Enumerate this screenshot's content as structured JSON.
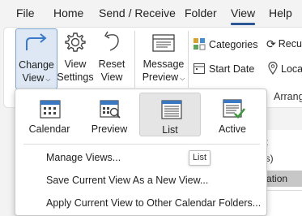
{
  "menubar": {
    "tabs": [
      {
        "label": "File"
      },
      {
        "label": "Home"
      },
      {
        "label": "Send / Receive"
      },
      {
        "label": "Folder"
      },
      {
        "label": "View"
      },
      {
        "label": "Help"
      }
    ],
    "active_tab": "View"
  },
  "ribbon": {
    "change_view": {
      "line1": "Change",
      "line2": "View"
    },
    "view_settings": {
      "line1": "View",
      "line2": "Settings"
    },
    "reset_view": {
      "line1": "Reset",
      "line2": "View"
    },
    "message_preview": {
      "line1": "Message",
      "line2": "Preview"
    },
    "categories": "Categories",
    "start_date": "Start Date",
    "recur": "Recur",
    "locat": "Locat",
    "arrang": "Arrang"
  },
  "dropdown": {
    "views": [
      {
        "label": "Calendar"
      },
      {
        "label": "Preview"
      },
      {
        "label": "List"
      },
      {
        "label": "Active"
      }
    ],
    "selected_view": "List",
    "items": [
      {
        "label": "Manage Views..."
      },
      {
        "label": "Save Current View As a New View..."
      },
      {
        "label": "Apply Current View to Other Calendar Folders..."
      }
    ]
  },
  "tooltip": {
    "text": "List"
  },
  "background_pane": {
    "col_header": "ict",
    "row1": "em(s)",
    "row2": "anisation"
  },
  "colors": {
    "accent": "#2b5797",
    "selected_button_bg": "#dde8f4",
    "selected_button_border": "#7aa3cf",
    "check_green": "#3a9a3a"
  }
}
